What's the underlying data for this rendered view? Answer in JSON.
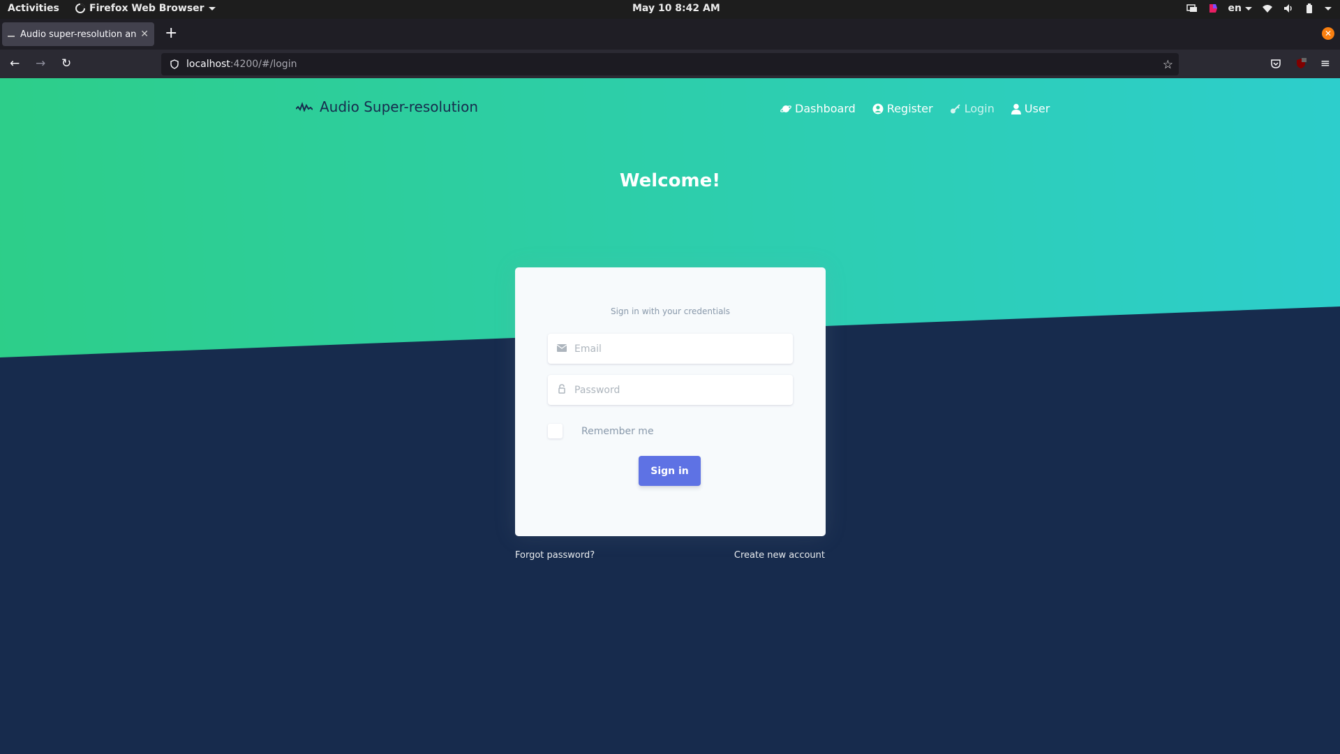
{
  "system_bar": {
    "activities": "Activities",
    "app_name": "Firefox Web Browser",
    "clock": "May 10  8:42 AM",
    "language": "en"
  },
  "browser": {
    "tab_title": "Audio super-resolution and",
    "url_host": "localhost",
    "url_path": ":4200/#/login"
  },
  "page": {
    "brand": "Audio Super-resolution",
    "nav": [
      {
        "label": "Dashboard",
        "icon": "planet-icon"
      },
      {
        "label": "Register",
        "icon": "user-circle-icon"
      },
      {
        "label": "Login",
        "icon": "key-icon"
      },
      {
        "label": "User",
        "icon": "person-icon"
      }
    ],
    "welcome": "Welcome!",
    "card": {
      "subtitle": "Sign in with your credentials",
      "email_placeholder": "Email",
      "password_placeholder": "Password",
      "remember_label": "Remember me",
      "signin_label": "Sign in"
    },
    "forgot_password": "Forgot password?",
    "create_account": "Create new account"
  },
  "colors": {
    "hero_gradient_start": "#2dce89",
    "hero_gradient_end": "#2dcecc",
    "background": "#172b4d",
    "primary": "#5e72e4"
  }
}
